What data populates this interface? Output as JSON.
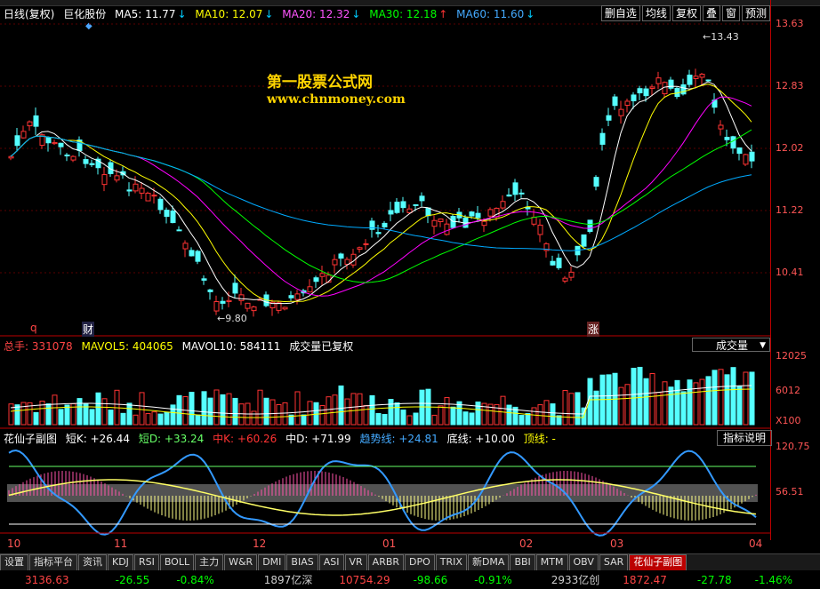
{
  "header": {
    "title": "日线(复权)",
    "stock": "巨化股份",
    "ma5": "MA5: 11.77",
    "ma10": "MA10: 12.07",
    "ma20": "MA20: 12.32",
    "ma30": "MA30: 12.18",
    "ma60": "MA60: 11.60",
    "colors": {
      "ma5": "#ffffff",
      "ma10": "#ffff00",
      "ma20": "#ff00ff",
      "ma30": "#00ff00",
      "ma60": "#00aaff"
    }
  },
  "toolbar": [
    "删自选",
    "均线",
    "复权",
    "叠",
    "窗",
    "预测"
  ],
  "watermark": {
    "line1": "第一股票公式网",
    "line2": "www.chnmoney.com"
  },
  "price_axis": [
    "13.63",
    "12.83",
    "12.02",
    "11.22",
    "10.41"
  ],
  "price_marks": {
    "high": "13.43",
    "low": "9.80"
  },
  "markers": {
    "q": "q",
    "cai": "财",
    "zhang": "涨"
  },
  "volume": {
    "label_total": "总手: 331078",
    "mavol5": "MAVOL5: 404065",
    "mavol10": "MAVOL10: 584111",
    "note": "成交量已复权",
    "dropdown": "成交量",
    "axis": [
      "12025",
      "6012",
      "X100"
    ]
  },
  "indicator": {
    "name": "花仙子副图",
    "shortk": "短K: +26.44",
    "shortd": "短D: +33.24",
    "midk": "中K: +60.26",
    "midd": "中D: +71.99",
    "trend": "趋势线: +24.81",
    "bottom": "底线: +10.00",
    "top": "顶线: -",
    "help": "指标说明",
    "axis": [
      "120.75",
      "56.51"
    ]
  },
  "months": [
    "10",
    "11",
    "12",
    "01",
    "02",
    "03",
    "04"
  ],
  "tabs": [
    "设置",
    "指标平台",
    "资讯",
    "KDJ",
    "RSI",
    "BOLL",
    "主力",
    "W&R",
    "DMI",
    "BIAS",
    "ASI",
    "VR",
    "ARBR",
    "DPO",
    "TRIX",
    "新DMA",
    "BBI",
    "MTM",
    "OBV",
    "SAR",
    "花仙子副图"
  ],
  "status": {
    "idx1": "3136.63",
    "chg1": "-26.55",
    "pct1": "-0.84%",
    "amt1": "1897亿",
    "name2": "深",
    "idx2": "10754.29",
    "chg2": "-98.66",
    "pct2": "-0.91%",
    "amt2": "2933亿",
    "name3": "创",
    "idx3": "1872.47",
    "chg3": "-27.78",
    "pct3": "-1.46%"
  }
}
